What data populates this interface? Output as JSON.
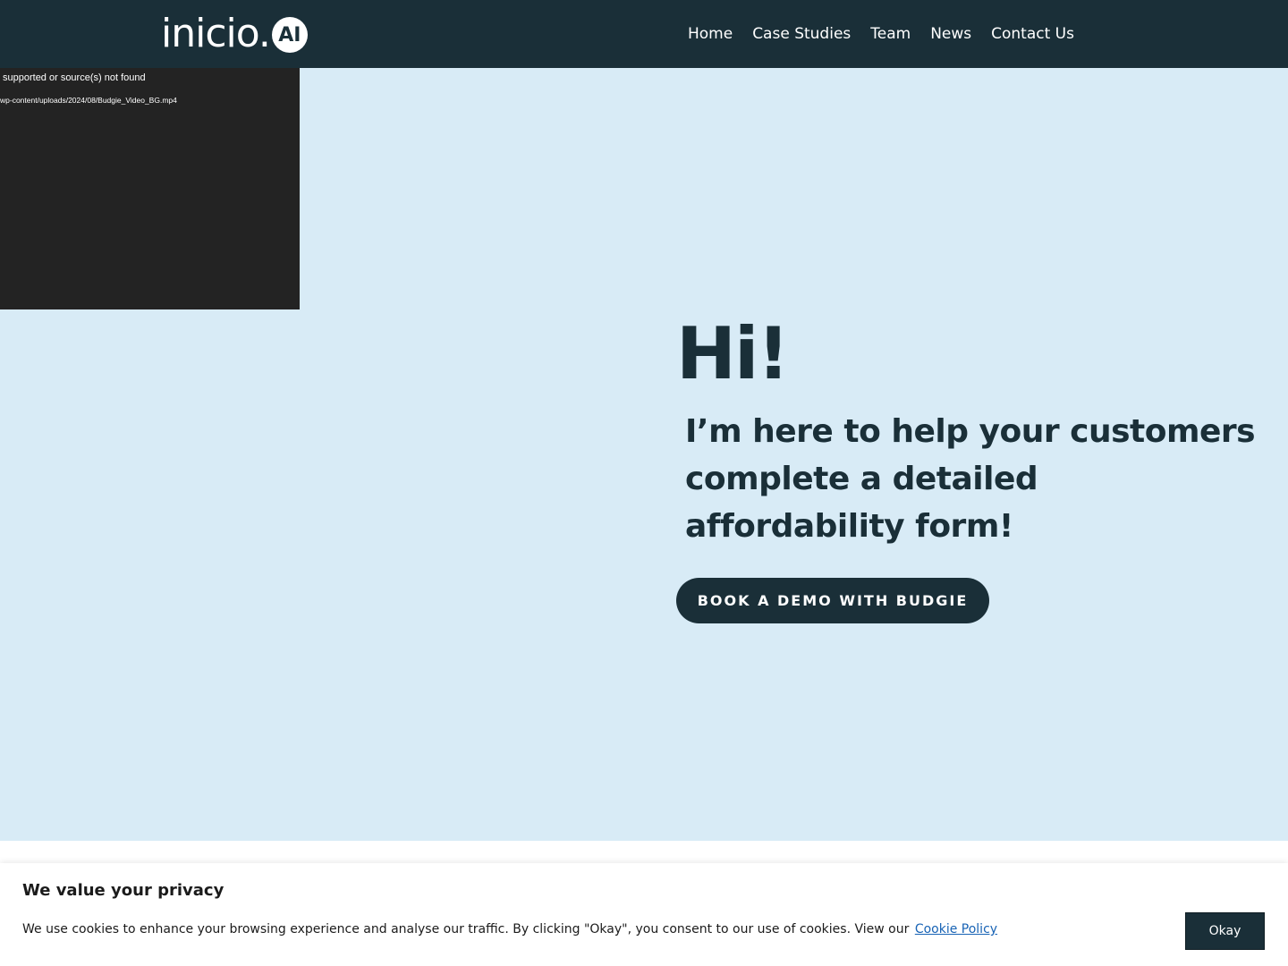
{
  "header": {
    "logo_text": "inicio.",
    "logo_badge": "AI",
    "nav": [
      "Home",
      "Case Studies",
      "Team",
      "News",
      "Contact Us"
    ]
  },
  "video": {
    "error_text": " supported or source(s) not found",
    "source_text": "wp-content/uploads/2024/08/Budgie_Video_BG.mp4"
  },
  "hero": {
    "greeting": "Hi!",
    "subtitle": "I’m here to help your customers complete a detailed affordability form!",
    "cta_label": "BOOK A DEMO WITH BUDGIE"
  },
  "cookie_banner": {
    "title": "We value your privacy",
    "text": "We use cookies to enhance your browsing experience and analyse our traffic. By clicking \"Okay\", you consent to our use of cookies. View our",
    "link_label": "Cookie Policy",
    "button_label": "Okay"
  },
  "colors": {
    "primary": "#1a2f38",
    "hero_background": "#d8ebf6",
    "link": "#1863b5"
  }
}
